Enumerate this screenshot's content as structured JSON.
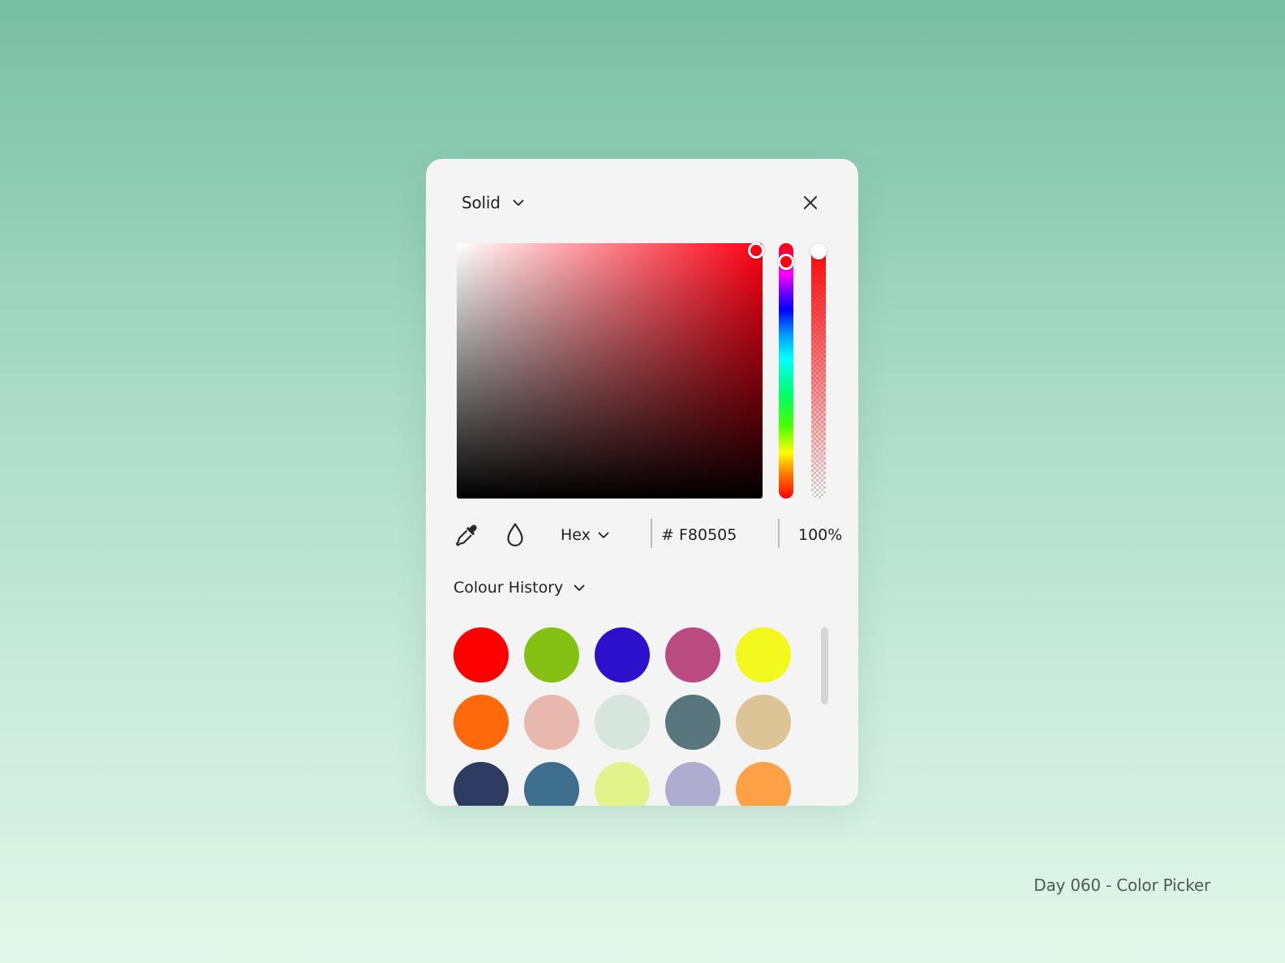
{
  "picker": {
    "fill_type": "Solid",
    "close_icon": "close-icon",
    "current_color": "#F80505",
    "hue_color": "#ff0014",
    "hue_position": 0.04,
    "saturation": 0.98,
    "brightness": 0.97,
    "alpha_position": 1.0
  },
  "toolbar": {
    "eyedropper_icon": "eyedropper-icon",
    "drop_icon": "drop-icon",
    "format": "Hex",
    "hex_value": "# F80505",
    "opacity": "100%"
  },
  "history": {
    "label": "Colour History",
    "swatches": [
      "#ff0000",
      "#84c112",
      "#2d10cc",
      "#b94b80",
      "#f3f81e",
      "#fe6a0b",
      "#e8b9ac",
      "#d7e5df",
      "#59767e",
      "#dcc496",
      "#2e3c61",
      "#3d6e8e",
      "#e2f38c",
      "#aeaccf",
      "#fea045"
    ]
  },
  "caption": "Day 060 - Color Picker"
}
